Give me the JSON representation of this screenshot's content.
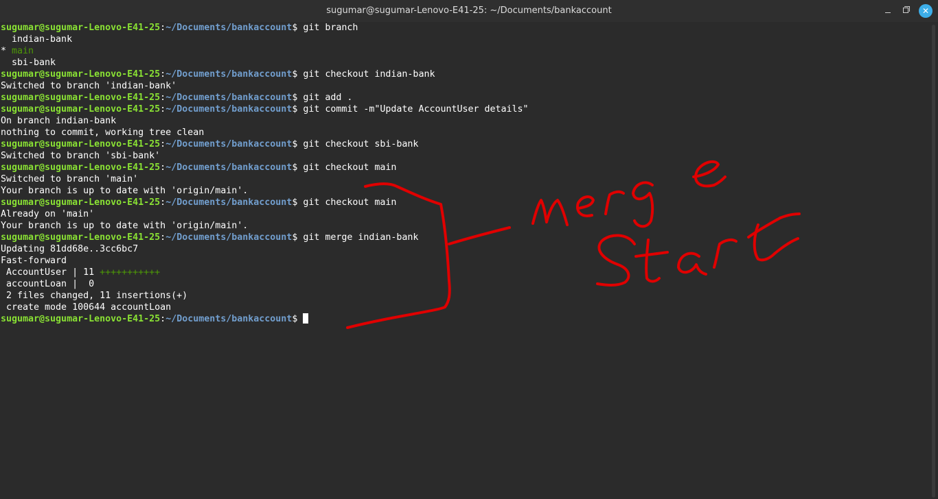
{
  "window": {
    "title": "sugumar@sugumar-Lenovo-E41-25: ~/Documents/bankaccount",
    "buttons": {
      "minimize": "minimize",
      "maximize": "maximize",
      "close": "✕"
    }
  },
  "prompt": {
    "user": "sugumar@sugumar-Lenovo-E41-25",
    "colon": ":",
    "path": "~/Documents/bankaccount",
    "sign": "$ "
  },
  "lines": [
    {
      "prompt": true,
      "cmd": "git branch"
    },
    {
      "text": "  indian-bank"
    },
    {
      "text": "* ",
      "green": "main"
    },
    {
      "text": "  sbi-bank"
    },
    {
      "prompt": true,
      "cmd": "git checkout indian-bank"
    },
    {
      "text": "Switched to branch 'indian-bank'"
    },
    {
      "prompt": true,
      "cmd": "git add ."
    },
    {
      "prompt": true,
      "cmd": "git commit -m\"Update AccountUser details\""
    },
    {
      "text": "On branch indian-bank"
    },
    {
      "text": "nothing to commit, working tree clean"
    },
    {
      "prompt": true,
      "cmd": "git checkout sbi-bank"
    },
    {
      "text": "Switched to branch 'sbi-bank'"
    },
    {
      "prompt": true,
      "cmd": "git checkout main"
    },
    {
      "text": "Switched to branch 'main'"
    },
    {
      "text": "Your branch is up to date with 'origin/main'."
    },
    {
      "prompt": true,
      "cmd": "git checkout main"
    },
    {
      "text": "Already on 'main'"
    },
    {
      "text": "Your branch is up to date with 'origin/main'."
    },
    {
      "prompt": true,
      "cmd": "git merge indian-bank"
    },
    {
      "text": "Updating 81dd68e..3cc6bc7"
    },
    {
      "text": "Fast-forward"
    },
    {
      "text": " AccountUser | 11 ",
      "green": "+++++++++++"
    },
    {
      "text": " accountLoan |  0"
    },
    {
      "text": " 2 files changed, 11 insertions(+)"
    },
    {
      "text": " create mode 100644 accountLoan"
    },
    {
      "prompt": true,
      "cmd": "",
      "cursor": true
    }
  ],
  "annotation": {
    "words": [
      "merge",
      "Start"
    ],
    "color": "#e00000"
  },
  "colors": {
    "background": "#2b2b2b",
    "prompt_user": "#8ae234",
    "prompt_path": "#729fcf",
    "diff_green": "#4e9a06",
    "close_button": "#3daee9"
  }
}
